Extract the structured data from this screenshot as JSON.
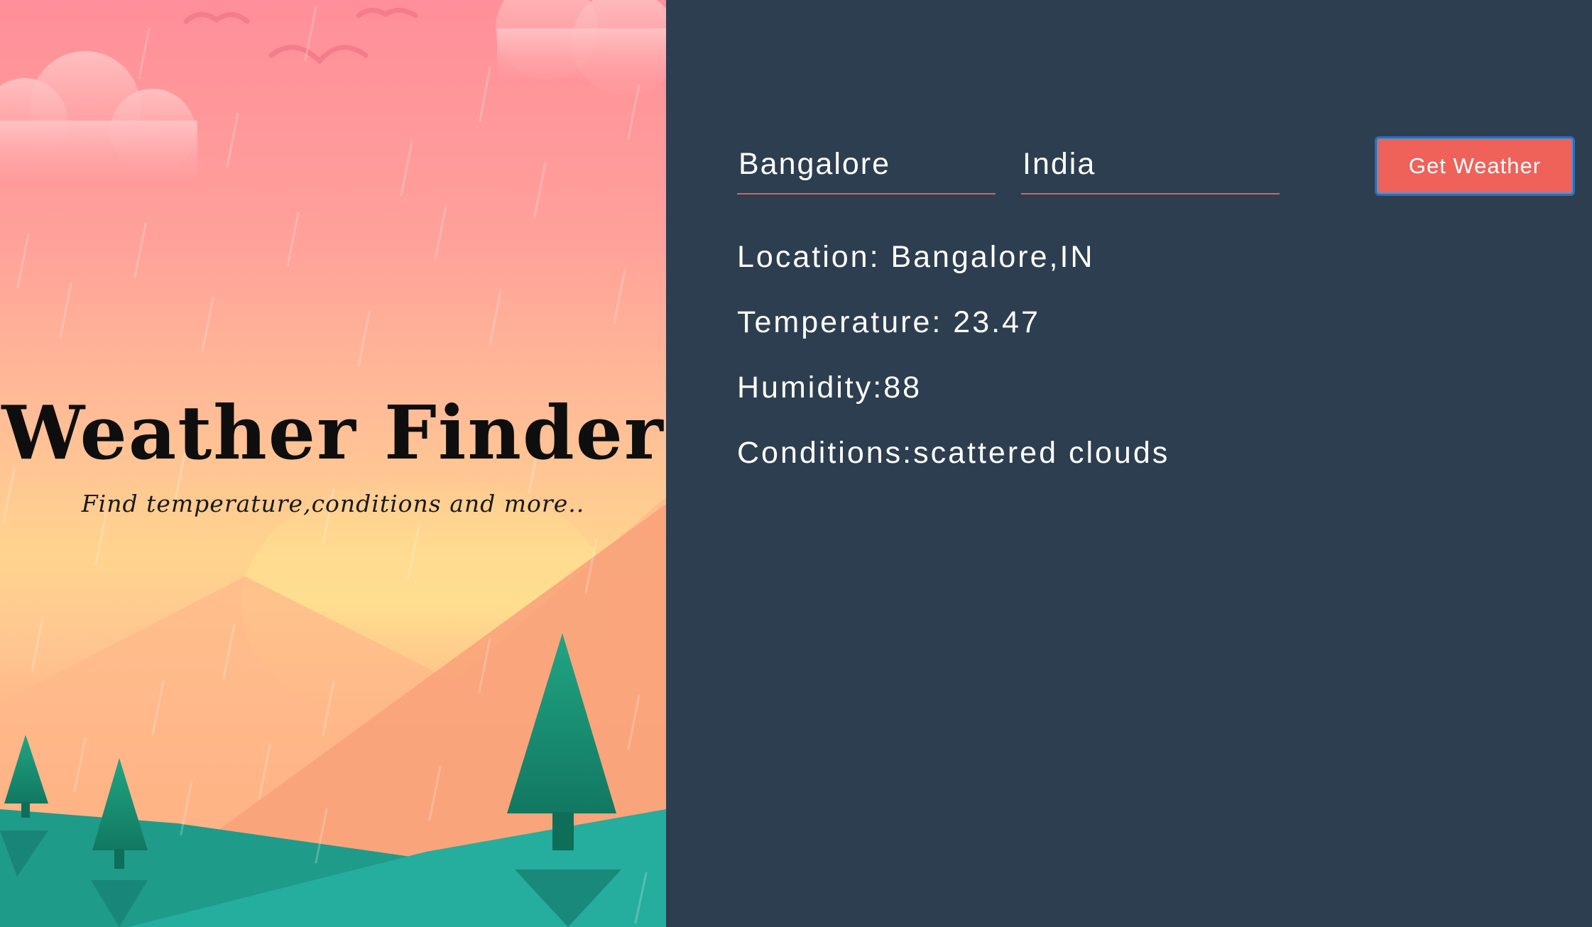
{
  "hero": {
    "title": "Weather Finder",
    "subtitle": "Find temperature,conditions and more.."
  },
  "form": {
    "city_value": "Bangalore",
    "country_value": "India",
    "submit_label": "Get Weather"
  },
  "results": {
    "location": "Location: Bangalore,IN",
    "temperature": "Temperature: 23.47",
    "humidity": "Humidity:88",
    "conditions": "Conditions:scattered clouds"
  },
  "colors": {
    "panel_background": "#2d3e50",
    "accent": "#ef625a",
    "button_focus_border": "#2e6fb3",
    "text": "#ffffff"
  }
}
